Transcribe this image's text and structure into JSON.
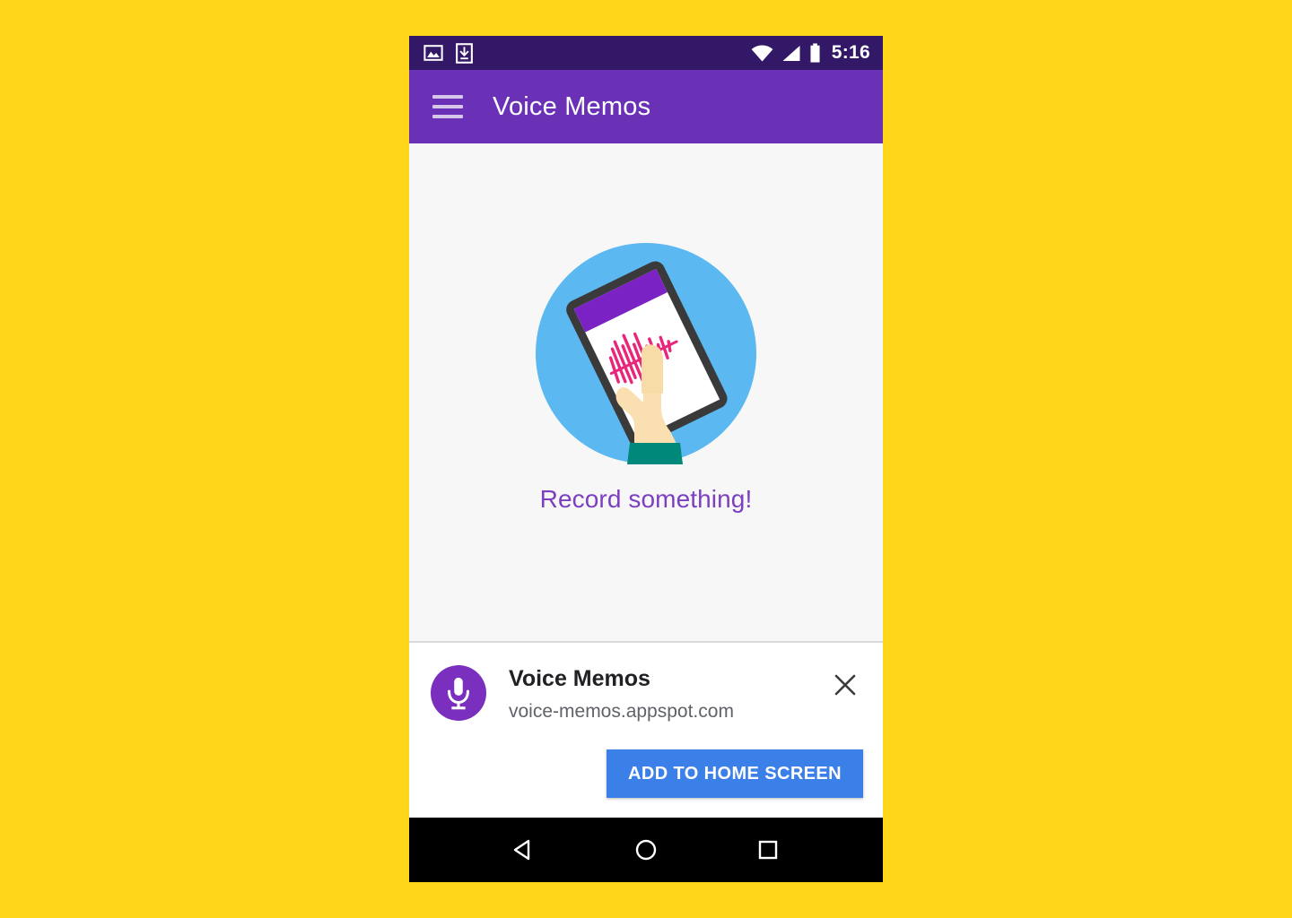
{
  "device": {
    "statusbar": {
      "left_icons": [
        "screenshot-image-icon",
        "download-icon"
      ],
      "right_icons": [
        "wifi-icon",
        "cellular-signal-icon",
        "battery-icon"
      ],
      "time": "5:16"
    },
    "navbar": {
      "back_label": "Back",
      "home_label": "Home",
      "recents_label": "Recent apps"
    }
  },
  "appbar": {
    "menu_icon": "hamburger-menu-icon",
    "title": "Voice Memos"
  },
  "content": {
    "illustration_name": "hand-holding-phone-recording-illustration",
    "empty_message": "Record something!"
  },
  "banner": {
    "app_icon": "microphone-icon",
    "title": "Voice Memos",
    "url": "voice-memos.appspot.com",
    "close_icon": "close-icon",
    "install_button": "ADD TO HOME SCREEN"
  },
  "colors": {
    "page_background": "#FFD61A",
    "statusbar": "#331868",
    "appbar": "#6A30B5",
    "content_background": "#F7F7F7",
    "empty_message_text": "#7B3FBF",
    "app_icon_background": "#7B2FBE",
    "install_button": "#3B7FE8",
    "navbar": "#000000",
    "illustration_circle": "#5BB8F0",
    "illustration_waveform": "#E8267A",
    "illustration_sleeve": "#00897B",
    "illustration_skin": "#FAE0B0"
  }
}
